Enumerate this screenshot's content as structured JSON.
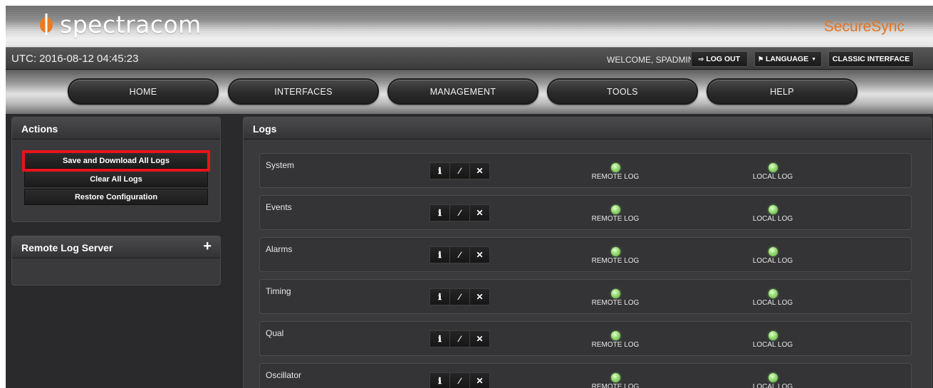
{
  "header": {
    "brand": "spectracom",
    "product": "SecureSync"
  },
  "statusbar": {
    "utc": "UTC: 2016-08-12 04:45:23",
    "welcome": "WELCOME, SPADMIN",
    "logout": "LOG OUT",
    "language": "LANGUAGE",
    "classic": "CLASSIC INTERFACE"
  },
  "nav": [
    {
      "label": "HOME"
    },
    {
      "label": "INTERFACES"
    },
    {
      "label": "MANAGEMENT"
    },
    {
      "label": "TOOLS"
    },
    {
      "label": "HELP"
    }
  ],
  "actions": {
    "title": "Actions",
    "items": [
      {
        "label": "Save and Download All Logs"
      },
      {
        "label": "Clear All Logs"
      },
      {
        "label": "Restore Configuration"
      }
    ]
  },
  "remote_log_server": {
    "title": "Remote Log Server",
    "add": "+"
  },
  "logs": {
    "title": "Logs",
    "remote_label": "REMOTE LOG",
    "local_label": "LOCAL LOG",
    "rows": [
      {
        "name": "System"
      },
      {
        "name": "Events"
      },
      {
        "name": "Alarms"
      },
      {
        "name": "Timing"
      },
      {
        "name": "Qual"
      },
      {
        "name": "Oscillator"
      }
    ]
  },
  "colors": {
    "accent": "#e4741e",
    "highlight": "#e8141c",
    "led_on": "#7fd055"
  },
  "icons": [
    "logo-mark-icon",
    "logout-icon",
    "flag-icon",
    "caret-icon",
    "info-icon",
    "edit-icon",
    "delete-icon",
    "plus-icon"
  ]
}
